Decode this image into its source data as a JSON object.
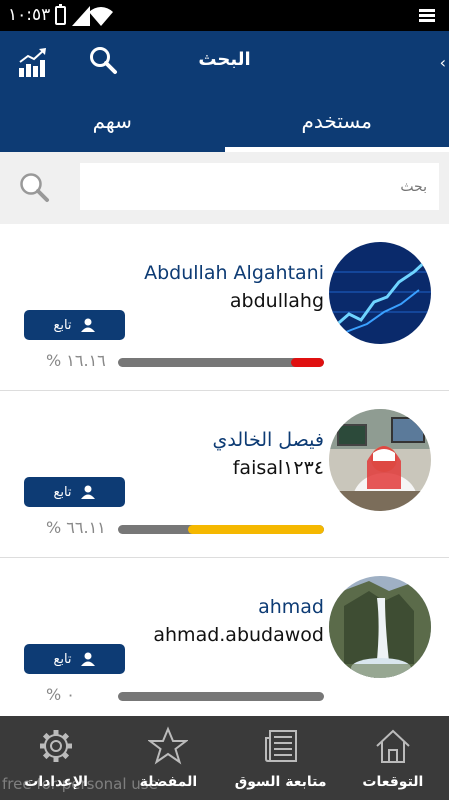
{
  "status_bar": {
    "time": "١٠:٥٣"
  },
  "header": {
    "title": "البحث",
    "back_glyph": "‹"
  },
  "tabs": [
    {
      "label": "مستخدم",
      "active": true
    },
    {
      "label": "سهم",
      "active": false
    }
  ],
  "search": {
    "placeholder": "بحث"
  },
  "users": [
    {
      "name": "Abdullah Algahtani",
      "handle": "abdullahg",
      "follow_label": "تابع",
      "percent_text": "% ١٦.١٦",
      "progress": 0.16,
      "progress_color": "#e01010",
      "avatar": "blue-chart-avatar"
    },
    {
      "name": "فيصل الخالدي",
      "handle": "faisal١٢٣٤",
      "follow_label": "تابع",
      "percent_text": "% ٦٦.١١",
      "progress": 0.66,
      "progress_color": "#f5b800",
      "avatar": "man-at-desk-avatar"
    },
    {
      "name": "ahmad",
      "handle": "ahmad.abudawod",
      "follow_label": "تابع",
      "percent_text": "% ٠",
      "progress": 0,
      "progress_color": "#e01010",
      "avatar": "waterfall-avatar"
    }
  ],
  "bottom_nav": [
    {
      "label": "التوقعات",
      "icon": "house-icon"
    },
    {
      "label": "متابعة السوق",
      "icon": "newspaper-icon"
    },
    {
      "label": "المفضلة",
      "icon": "star-icon"
    },
    {
      "label": "الإعدادات",
      "icon": "gear-icon"
    }
  ],
  "watermark": "free for personal use",
  "colors": {
    "primary": "#0d3b74",
    "nav_bg": "#3a3a3a"
  }
}
